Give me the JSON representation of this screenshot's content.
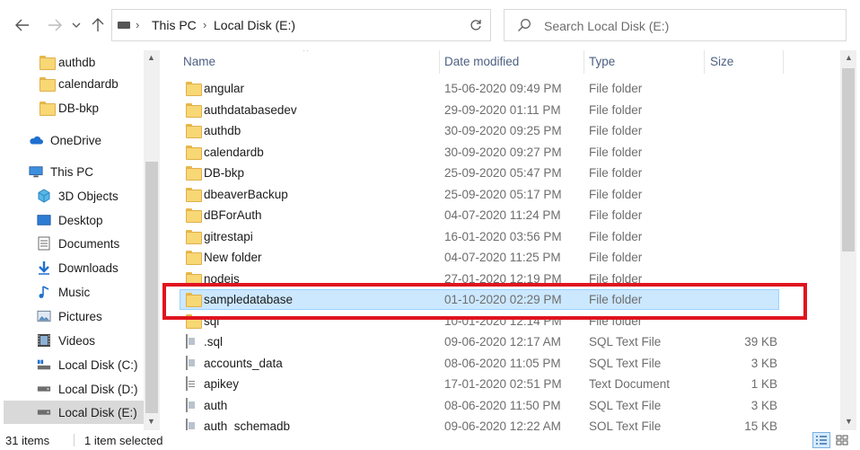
{
  "toolbar": {
    "back_icon": "arrow-left-icon",
    "forward_icon": "arrow-right-icon",
    "recent_icon": "chevron-down-icon",
    "up_icon": "arrow-up-icon",
    "refresh_icon": "refresh-icon"
  },
  "address": {
    "crumbs": [
      "This PC",
      "Local Disk (E:)"
    ]
  },
  "search": {
    "placeholder": "Search Local Disk (E:)"
  },
  "nav": {
    "items": [
      {
        "label": "authdb",
        "icon": "folder-icon"
      },
      {
        "label": "calendardb",
        "icon": "folder-icon"
      },
      {
        "label": "DB-bkp",
        "icon": "folder-icon"
      },
      {
        "label": "OneDrive",
        "icon": "cloud-icon"
      },
      {
        "label": "This PC",
        "icon": "computer-icon"
      },
      {
        "label": "3D Objects",
        "icon": "cube-icon"
      },
      {
        "label": "Desktop",
        "icon": "desktop-icon"
      },
      {
        "label": "Documents",
        "icon": "documents-icon"
      },
      {
        "label": "Downloads",
        "icon": "download-icon"
      },
      {
        "label": "Music",
        "icon": "music-icon"
      },
      {
        "label": "Pictures",
        "icon": "pictures-icon"
      },
      {
        "label": "Videos",
        "icon": "videos-icon"
      },
      {
        "label": "Local Disk (C:)",
        "icon": "drive-icon"
      },
      {
        "label": "Local Disk (D:)",
        "icon": "drive-icon"
      },
      {
        "label": "Local Disk (E:)",
        "icon": "drive-icon"
      }
    ]
  },
  "columns": {
    "name": "Name",
    "date": "Date modified",
    "type": "Type",
    "size": "Size"
  },
  "files": [
    {
      "name": "angular",
      "date": "15-06-2020 09:49 PM",
      "type": "File folder",
      "size": "",
      "icon": "folder-icon"
    },
    {
      "name": "authdatabasedev",
      "date": "29-09-2020 01:11 PM",
      "type": "File folder",
      "size": "",
      "icon": "folder-icon"
    },
    {
      "name": "authdb",
      "date": "30-09-2020 09:25 PM",
      "type": "File folder",
      "size": "",
      "icon": "folder-icon"
    },
    {
      "name": "calendardb",
      "date": "30-09-2020 09:27 PM",
      "type": "File folder",
      "size": "",
      "icon": "folder-icon"
    },
    {
      "name": "DB-bkp",
      "date": "25-09-2020 05:47 PM",
      "type": "File folder",
      "size": "",
      "icon": "folder-icon"
    },
    {
      "name": "dbeaverBackup",
      "date": "25-09-2020 05:17 PM",
      "type": "File folder",
      "size": "",
      "icon": "folder-icon"
    },
    {
      "name": "dBForAuth",
      "date": "04-07-2020 11:24 PM",
      "type": "File folder",
      "size": "",
      "icon": "folder-icon"
    },
    {
      "name": "gitrestapi",
      "date": "16-01-2020 03:56 PM",
      "type": "File folder",
      "size": "",
      "icon": "folder-icon"
    },
    {
      "name": "New folder",
      "date": "04-07-2020 11:25 PM",
      "type": "File folder",
      "size": "",
      "icon": "folder-icon"
    },
    {
      "name": "nodejs",
      "date": "27-01-2020 12:19 PM",
      "type": "File folder",
      "size": "",
      "icon": "folder-icon"
    },
    {
      "name": "sampledatabase",
      "date": "01-10-2020 02:29 PM",
      "type": "File folder",
      "size": "",
      "icon": "folder-icon",
      "selected": true
    },
    {
      "name": "sql",
      "date": "10-01-2020 12:14 PM",
      "type": "File folder",
      "size": "",
      "icon": "folder-icon"
    },
    {
      "name": ".sql",
      "date": "09-06-2020 12:17 AM",
      "type": "SQL Text File",
      "size": "39 KB",
      "icon": "sql-file-icon"
    },
    {
      "name": "accounts_data",
      "date": "08-06-2020 11:05 PM",
      "type": "SQL Text File",
      "size": "3 KB",
      "icon": "sql-file-icon"
    },
    {
      "name": "apikey",
      "date": "17-01-2020 02:51 PM",
      "type": "Text Document",
      "size": "1 KB",
      "icon": "text-file-icon"
    },
    {
      "name": "auth",
      "date": "08-06-2020 11:50 PM",
      "type": "SQL Text File",
      "size": "3 KB",
      "icon": "sql-file-icon"
    },
    {
      "name": "auth_schemadb",
      "date": "09-06-2020 12:22 AM",
      "type": "SQL Text File",
      "size": "15 KB",
      "icon": "sql-file-icon"
    }
  ],
  "status": {
    "count": "31 items",
    "selection": "1 item selected",
    "details_view_icon": "details-view-icon",
    "tiles_view_icon": "large-icons-view-icon"
  },
  "colors": {
    "selection_fill": "#cce8ff",
    "selection_border": "#99d1ff",
    "annotation_red": "#e0141e",
    "folder_yellow": "#f8d775"
  }
}
